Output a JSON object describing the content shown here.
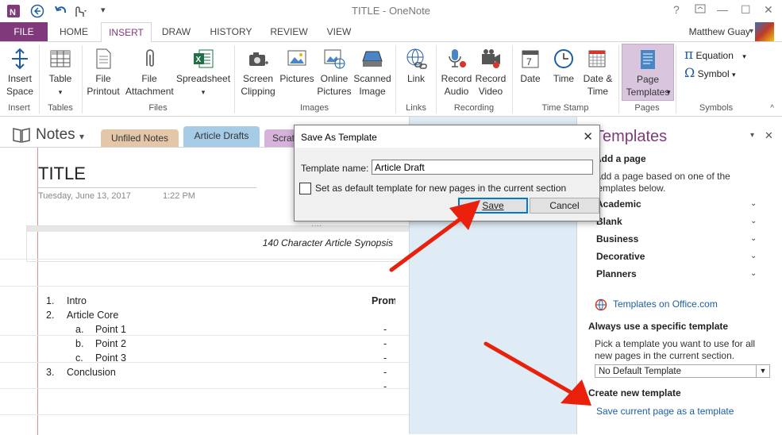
{
  "titlebar": {
    "app_title": "TITLE - OneNote",
    "quick_access": [
      "back-icon",
      "undo-icon",
      "touch-mode-icon",
      "customize-icon"
    ],
    "window_controls": [
      "?",
      "restore-ribbon",
      "—",
      "☐",
      "✕"
    ]
  },
  "ribbon_tabs": {
    "file": "FILE",
    "home": "HOME",
    "insert": "INSERT",
    "draw": "DRAW",
    "history": "HISTORY",
    "review": "REVIEW",
    "view": "VIEW",
    "user": "Matthew Guay"
  },
  "ribbon": {
    "insert_space": "Insert Space",
    "table": "Table",
    "file_printout": "File Printout",
    "file_attachment": "File Attachment",
    "spreadsheet": "Spreadsheet",
    "screen_clipping": "Screen Clipping",
    "pictures": "Pictures",
    "online_pictures": "Online Pictures",
    "scanned_image": "Scanned Image",
    "link": "Link",
    "record_audio": "Record Audio",
    "record_video": "Record Video",
    "date": "Date",
    "time": "Time",
    "date_time": "Date & Time",
    "page_templates": "Page Templates",
    "equation": "Equation",
    "symbol": "Symbol",
    "groups": {
      "insert": "Insert",
      "tables": "Tables",
      "files": "Files",
      "images": "Images",
      "links": "Links",
      "recording": "Recording",
      "time_stamp": "Time Stamp",
      "pages": "Pages",
      "symbols": "Symbols"
    },
    "accent": "#80397b"
  },
  "notebook": {
    "title": "Notes",
    "sections": [
      "Unfiled Notes",
      "Article Drafts",
      "Scrat"
    ]
  },
  "page": {
    "title": "TITLE",
    "date": "Tuesday, June 13, 2017",
    "time": "1:22 PM",
    "synopsis": "140 Character Article Synopsis",
    "list": [
      {
        "n": "1.",
        "text": "Intro"
      },
      {
        "n": "2.",
        "text": "Article Core"
      },
      {
        "n": "a.",
        "text": "Point 1"
      },
      {
        "n": "b.",
        "text": "Point 2"
      },
      {
        "n": "c.",
        "text": "Point 3"
      },
      {
        "n": "3.",
        "text": "Conclusion"
      }
    ],
    "right_header": "Prom",
    "dashes": [
      "-",
      "-",
      "-",
      "-",
      "-"
    ]
  },
  "templates_pane": {
    "title": "Templates",
    "add_page_heading": "Add a page",
    "add_page_text": "Add a page based on one of the templates below.",
    "categories": [
      "Academic",
      "Blank",
      "Business",
      "Decorative",
      "Planners"
    ],
    "online_link": "Templates on Office.com",
    "always_heading": "Always use a specific template",
    "always_text": "Pick a template you want to use for all new pages in the current section.",
    "default_select": "No Default Template",
    "create_heading": "Create new template",
    "save_link": "Save current page as a template"
  },
  "dialog": {
    "title": "Save As Template",
    "name_label": "Template name:",
    "name_value": "Article Draft",
    "checkbox_label": "Set as default template for new pages in the current section",
    "save": "Save",
    "cancel": "Cancel"
  }
}
